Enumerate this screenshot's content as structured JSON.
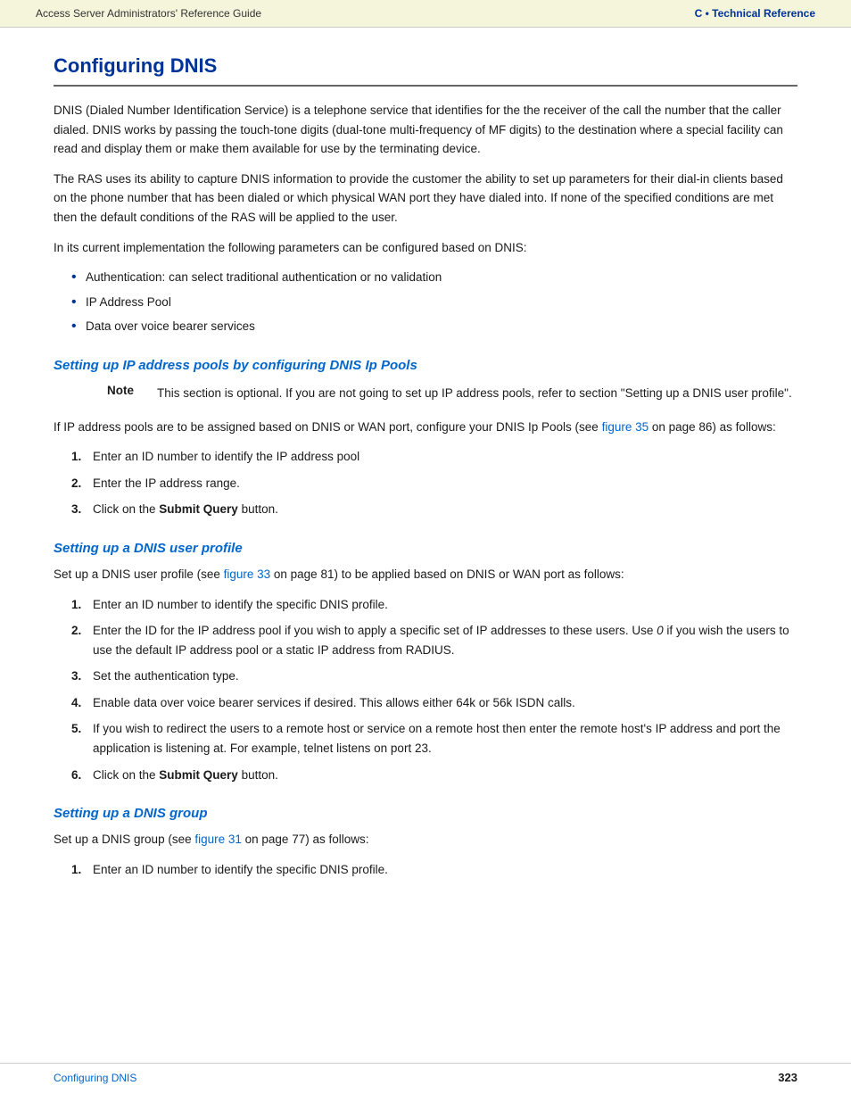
{
  "header": {
    "left_text": "Access Server Administrators' Reference Guide",
    "right_prefix": "C • ",
    "right_title": "Technical Reference"
  },
  "main": {
    "section_title": "Configuring DNIS",
    "paragraphs": [
      "DNIS (Dialed Number Identification Service) is a telephone service that identifies for the the receiver of the call the number that the caller dialed. DNIS works by passing the touch-tone digits (dual-tone multi-frequency of MF digits) to the destination where a special facility can read and display them or make them available for use by the terminating device.",
      "The RAS uses its ability to capture DNIS information to provide the customer the ability to set up parameters for their dial-in clients based on the phone number that has been dialed or which physical WAN port they have dialed into. If none of the specified conditions are met then the default conditions of the RAS will be applied to the user.",
      "In its current implementation the following parameters can be configured based on DNIS:"
    ],
    "bullet_items": [
      "Authentication: can select traditional authentication or no validation",
      "IP Address Pool",
      "Data over voice bearer services"
    ],
    "subsections": [
      {
        "id": "ip-pools",
        "title": "Setting up IP address pools by configuring DNIS Ip Pools",
        "note": {
          "label": "Note",
          "text": "This section is optional. If you are not going to set up IP address pools, refer to section \"Setting up a DNIS user profile\"."
        },
        "intro": "If IP address pools are to be assigned based on DNIS or WAN port, configure your DNIS Ip Pools (see ",
        "intro_link": "figure 35",
        "intro_suffix": " on page 86) as follows:",
        "steps": [
          "Enter an ID number to identify the IP address pool",
          "Enter the IP address range.",
          "Click on the <b>Submit Query</b> button."
        ]
      },
      {
        "id": "dnis-user-profile",
        "title": "Setting up a DNIS user profile",
        "intro": "Set up a DNIS user profile (see ",
        "intro_link": "figure 33",
        "intro_suffix": " on page 81) to be applied based on DNIS or WAN port as follows:",
        "steps": [
          "Enter an ID number to identify the specific DNIS profile.",
          "Enter the ID for the IP address pool if you wish to apply a specific set of IP addresses to these users.  Use <i>0</i> if you wish the users to use the default IP address pool or a static IP address from RADIUS.",
          "Set the authentication type.",
          "Enable data over voice bearer services if desired. This allows either 64k or 56k ISDN calls.",
          "If you wish to redirect the users to a remote host or service on a remote host then enter the remote host's IP address and port the application is listening at. For example, telnet listens on port 23.",
          "Click on the <b>Submit Query</b> button."
        ]
      },
      {
        "id": "dnis-group",
        "title": "Setting up a DNIS group",
        "intro": "Set up a DNIS group (see ",
        "intro_link": "figure 31",
        "intro_suffix": " on page 77) as follows:",
        "steps": [
          "Enter an ID number to identify the specific DNIS profile."
        ]
      }
    ]
  },
  "footer": {
    "left_text": "Configuring DNIS",
    "right_text": "323"
  }
}
